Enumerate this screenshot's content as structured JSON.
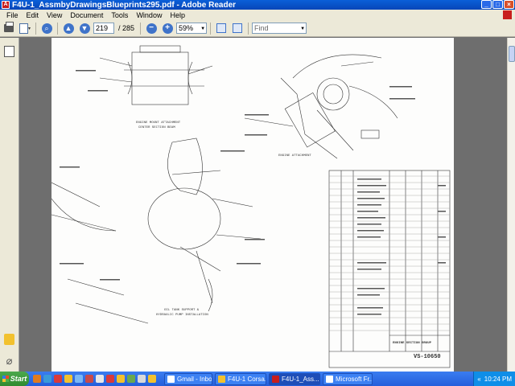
{
  "window": {
    "title": "F4U-1_AssmbyDrawingsBlueprints295.pdf - Adobe Reader",
    "controls": [
      "minimize",
      "maximize",
      "close"
    ]
  },
  "menu": [
    "File",
    "Edit",
    "View",
    "Document",
    "Tools",
    "Window",
    "Help"
  ],
  "toolbar": {
    "current_page": "219",
    "page_total": "/ 285",
    "zoom": "59%",
    "find_placeholder": "Find"
  },
  "drawing": {
    "labels": [
      "ENGINE MOUNT ATTACHMENT",
      "CENTER SECTION BEAM",
      "ENGINE ATTACHMENT",
      "OIL TANK SUPPORT &",
      "HYDRAULIC PUMP INSTALLATION"
    ],
    "title_block": "ENGINE SECTION GROUP",
    "drawing_number": "VS-10650"
  },
  "taskbar": {
    "start_label": "Start",
    "tasks": [
      {
        "label": "Gmail - Inbo...",
        "active": false
      },
      {
        "label": "F4U-1 Corsa...",
        "active": false
      },
      {
        "label": "F4U-1_Ass...",
        "active": true
      },
      {
        "label": "Microsoft Fr...",
        "active": false
      }
    ],
    "clock": "10:24 PM",
    "tray_arrow": "«"
  },
  "colors": {
    "titlebar": "#0746b8",
    "chrome": "#ece9d8",
    "taskbar": "#245edb",
    "start": "#2f8a2f"
  }
}
